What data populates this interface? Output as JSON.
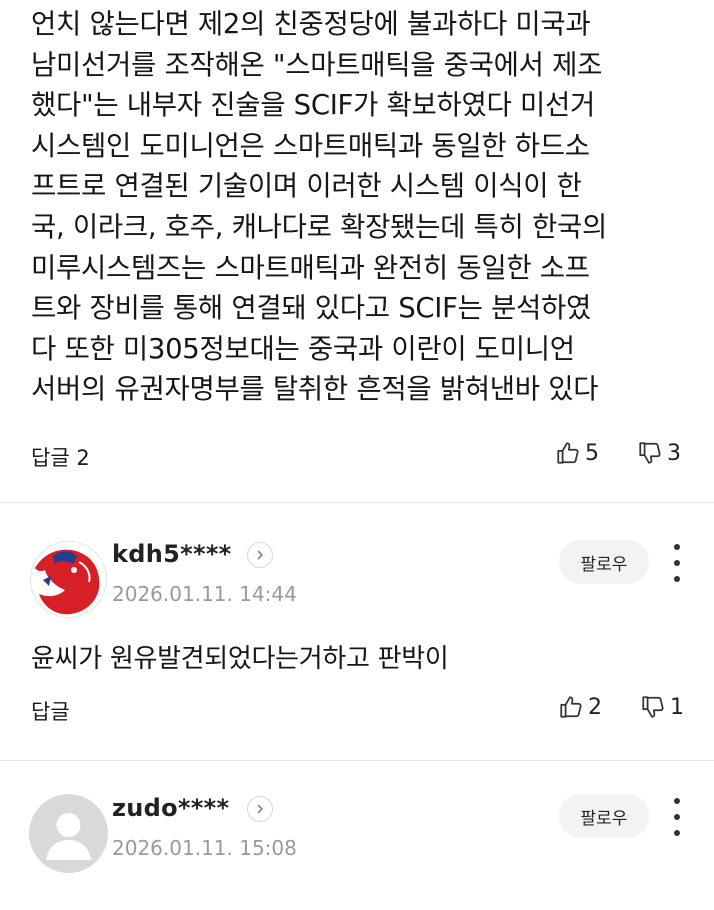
{
  "post": {
    "lines": [
      "언치 않는다면 제2의 친중정당에 불과하다 미국과",
      "남미선거를 조작해온 \"스마트매틱을 중국에서 제조",
      "했다\"는 내부자 진술을 SCIF가 확보하였다 미선거",
      "시스템인 도미니언은 스마트매틱과 동일한 하드소",
      "프트로 연결된 기술이며 이러한 시스템 이식이 한",
      "국, 이라크, 호주, 캐나다로 확장됐는데 특히 한국의",
      "미루시스템즈는 스마트매틱과 완전히 동일한 소프",
      "트와 장비를 통해 연결돼 있다고 SCIF는 분석하였",
      "다 또한 미305정보대는 중국과 이란이 도미니언",
      "서버의 유권자명부를 탈취한 흔적을 밝혀낸바 있다"
    ],
    "reply_label": "답글 2",
    "likes": "5",
    "dislikes": "3"
  },
  "comments": [
    {
      "username": "kdh5****",
      "timestamp": "2026.01.11. 14:44",
      "follow_label": "팔로우",
      "text": "윤씨가 원유발견되었다는거하고 판박이",
      "reply_label": "답글",
      "likes": "2",
      "dislikes": "1",
      "avatar_icon": "red-team-logo-avatar"
    },
    {
      "username": "zudo****",
      "timestamp": "2026.01.11. 15:08",
      "follow_label": "팔로우",
      "avatar_icon": "default-user-avatar"
    }
  ],
  "icons": {
    "like": "thumbs-up-icon",
    "dislike": "thumbs-down-icon",
    "chevron": "chevron-right-icon",
    "more": "more-vertical-icon"
  }
}
